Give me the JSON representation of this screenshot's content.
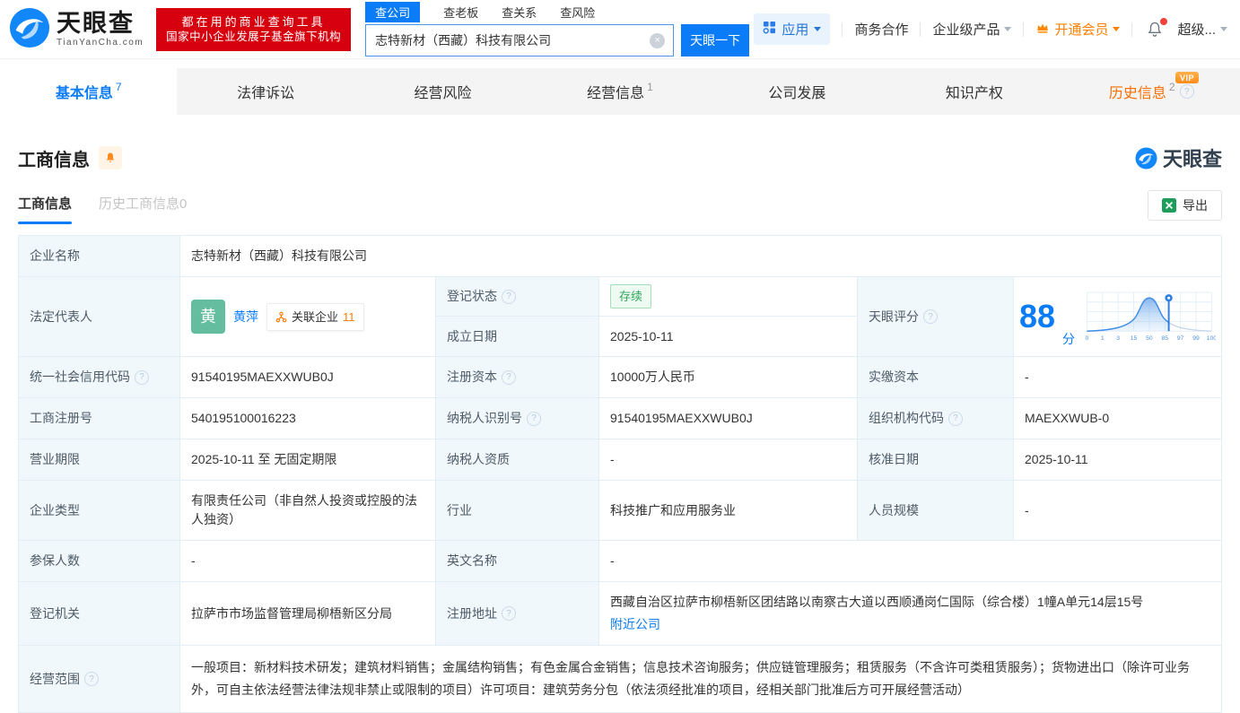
{
  "colors": {
    "accent": "#0a7cf8",
    "orange": "#ff8000",
    "brand_red": "#d6000f",
    "status_green": "#2fa85c",
    "avatar_green": "#65bda0"
  },
  "header": {
    "logo": {
      "title": "天眼查",
      "domain": "TianYanCha.com"
    },
    "promo": {
      "line1": "都在用的商业查询工具",
      "line2": "国家中小企业发展子基金旗下机构"
    },
    "search": {
      "tabs": [
        {
          "label": "查公司"
        },
        {
          "label": "查老板"
        },
        {
          "label": "查关系"
        },
        {
          "label": "查风险"
        }
      ],
      "value": "志特新材（西藏）科技有限公司",
      "button": "天眼一下"
    },
    "menu": {
      "apps": "应用",
      "cooperation": "商务合作",
      "enterprise": "企业级产品",
      "vip": "开通会员",
      "super": "超级..."
    }
  },
  "nav": {
    "vip_badge": "VIP",
    "tabs": [
      {
        "label": "基本信息",
        "count": "7"
      },
      {
        "label": "法律诉讼"
      },
      {
        "label": "经营风险"
      },
      {
        "label": "经营信息",
        "count": "1"
      },
      {
        "label": "公司发展"
      },
      {
        "label": "知识产权"
      },
      {
        "label": "历史信息",
        "count": "2"
      }
    ]
  },
  "section": {
    "title": "工商信息",
    "watermark": "天眼查",
    "tabs": [
      {
        "label": "工商信息"
      },
      {
        "label": "历史工商信息0"
      }
    ],
    "export_label": "导出"
  },
  "table": {
    "company_name": {
      "label": "企业名称",
      "value": "志特新材（西藏）科技有限公司"
    },
    "legal_rep": {
      "label": "法定代表人",
      "avatar": "黄",
      "name": "黄萍",
      "related_label": "关联企业",
      "related_count": "11"
    },
    "reg_status": {
      "label": "登记状态",
      "value": "存续"
    },
    "establish_date": {
      "label": "成立日期",
      "value": "2025-10-11"
    },
    "score": {
      "label": "天眼评分",
      "value": "88",
      "unit": "分",
      "axis": [
        "0",
        "1",
        "3",
        "15",
        "50",
        "85",
        "97",
        "99",
        "100"
      ]
    },
    "credit_code": {
      "label": "统一社会信用代码",
      "value": "91540195MAEXXWUB0J"
    },
    "reg_capital": {
      "label": "注册资本",
      "value": "10000万人民币"
    },
    "paid_capital": {
      "label": "实缴资本",
      "value": "-"
    },
    "reg_number": {
      "label": "工商注册号",
      "value": "540195100016223"
    },
    "taxpayer_id": {
      "label": "纳税人识别号",
      "value": "91540195MAEXXWUB0J"
    },
    "org_code": {
      "label": "组织机构代码",
      "value": "MAEXXWUB-0"
    },
    "business_term": {
      "label": "营业期限",
      "value": "2025-10-11 至 无固定期限"
    },
    "taxpayer_quality": {
      "label": "纳税人资质",
      "value": "-"
    },
    "approval_date": {
      "label": "核准日期",
      "value": "2025-10-11"
    },
    "company_type": {
      "label": "企业类型",
      "value": "有限责任公司（非自然人投资或控股的法人独资）"
    },
    "industry": {
      "label": "行业",
      "value": "科技推广和应用服务业"
    },
    "staff_size": {
      "label": "人员规模",
      "value": "-"
    },
    "insured_count": {
      "label": "参保人数",
      "value": "-"
    },
    "english_name": {
      "label": "英文名称",
      "value": "-"
    },
    "reg_authority": {
      "label": "登记机关",
      "value": "拉萨市市场监督管理局柳梧新区分局"
    },
    "reg_address": {
      "label": "注册地址",
      "value": "西藏自治区拉萨市柳梧新区团结路以南察古大道以西顺通岗仁国际（综合楼）1幢A单元14层15号",
      "nearby_link": "附近公司"
    },
    "business_scope": {
      "label": "经营范围",
      "value": "一般项目：新材料技术研发；建筑材料销售；金属结构销售；有色金属合金销售；信息技术咨询服务；供应链管理服务；租赁服务（不含许可类租赁服务）；货物进出口（除许可业务外，可自主依法经营法律法规非禁止或限制的项目）许可项目：建筑劳务分包（依法须经批准的项目，经相关部门批准后方可开展经营活动）"
    }
  }
}
